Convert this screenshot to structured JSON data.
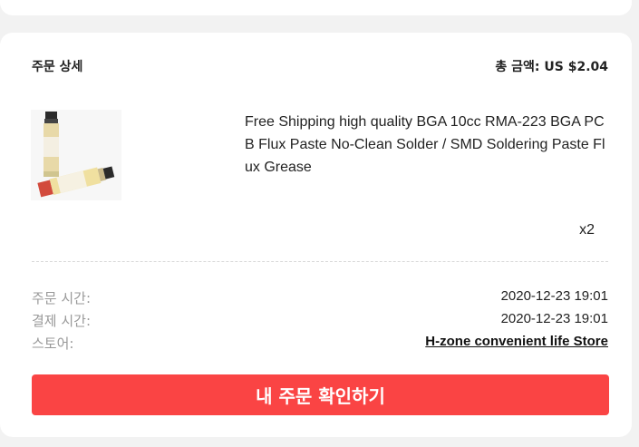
{
  "order": {
    "section_title": "주문 상세",
    "total_label": "총 금액:",
    "total_value": "US $2.04"
  },
  "product": {
    "image_icon": "flux-paste-syringe-image",
    "title": "Free Shipping high quality BGA 10cc RMA-223 BGA PCB Flux Paste No-Clean Solder / SMD Soldering Paste Flux Grease",
    "quantity": "x2"
  },
  "details": {
    "order_time_label": "주문 시간:",
    "order_time_value": "2020-12-23 19:01",
    "payment_time_label": "결제 시간:",
    "payment_time_value": "2020-12-23 19:01",
    "store_label": "스토어:",
    "store_value": "H-zone convenient life Store"
  },
  "actions": {
    "view_orders_label": "내 주문 확인하기"
  },
  "colors": {
    "accent": "#fa4444",
    "background": "#f2f2f2",
    "card": "#ffffff"
  }
}
